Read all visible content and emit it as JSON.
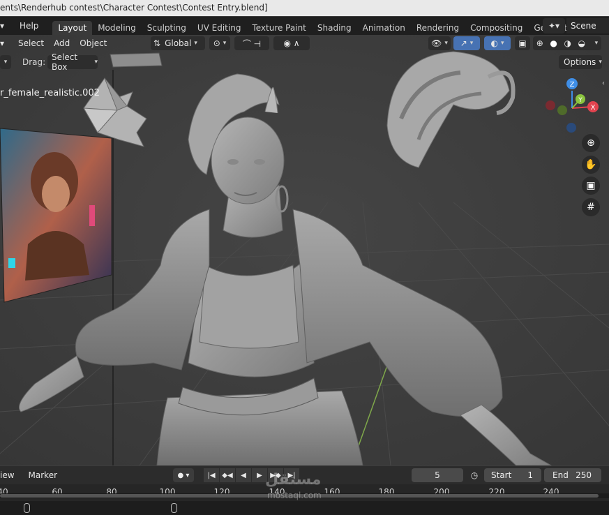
{
  "window": {
    "title": "ents\\Renderhub contest\\Character Contest\\Contest Entry.blend]"
  },
  "topbar": {
    "menu": [
      "Help"
    ],
    "workspaces": [
      "Layout",
      "Modeling",
      "Sculpting",
      "UV Editing",
      "Texture Paint",
      "Shading",
      "Animation",
      "Rendering",
      "Compositing",
      "Geometry Noc"
    ],
    "active_workspace": "Layout",
    "scene": "Scene"
  },
  "viewport_header": {
    "menu": [
      "Select",
      "Add",
      "Object"
    ],
    "transform_orientation": "Global",
    "options_label": "Options"
  },
  "tool_settings": {
    "drag_label": "Drag:",
    "drag_value": "Select Box"
  },
  "viewport": {
    "object_name": "r_female_realistic.002",
    "gizmo": {
      "x": "X",
      "y": "Y",
      "z": "Z"
    }
  },
  "timeline": {
    "menu": [
      "iew",
      "Marker"
    ],
    "current_frame": "5",
    "start_label": "Start",
    "start_value": "1",
    "end_label": "End",
    "end_value": "250",
    "ruler_ticks": [
      "40",
      "60",
      "80",
      "100",
      "120",
      "140",
      "160",
      "180",
      "200",
      "220",
      "240"
    ]
  },
  "watermark": {
    "arabic": "مستقل",
    "latin": "mostaql.com"
  },
  "colors": {
    "axis_x": "#e2434f",
    "axis_y": "#8bc43f",
    "axis_z": "#3f8ee6",
    "accent": "#4772b3"
  }
}
